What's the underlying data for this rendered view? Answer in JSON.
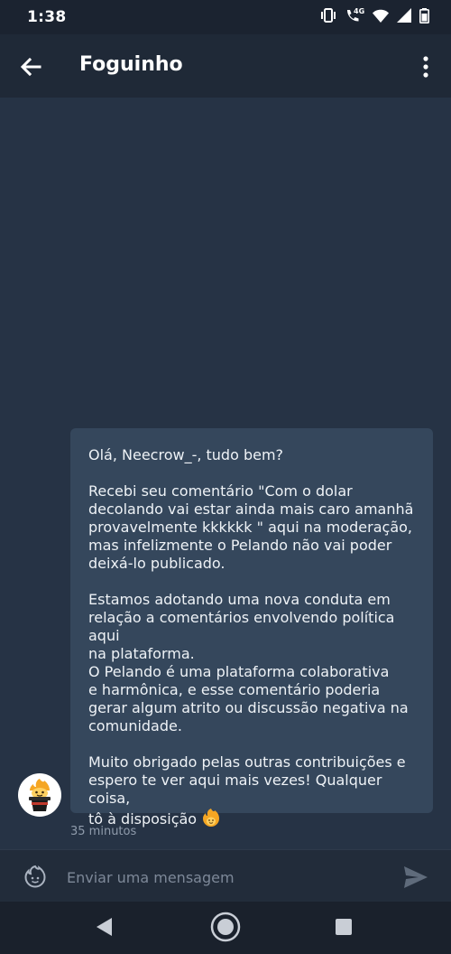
{
  "status_bar": {
    "time": "1:38",
    "network_label": "4G",
    "icons": [
      "vibrate-icon",
      "phone-4g-icon",
      "wifi-icon",
      "cell-signal-icon",
      "battery-icon"
    ]
  },
  "header": {
    "back_icon": "arrow-left-icon",
    "title": "Foguinho",
    "menu_icon": "more-vertical-icon"
  },
  "conversation": {
    "messages": [
      {
        "sender_avatar": "foguinho-mascot-avatar",
        "paragraphs": [
          "Olá, Neecrow_-, tudo bem?",
          "Recebi seu comentário \"Com o dolar\ndecolando vai estar ainda mais caro amanhã\nprovavelmente kkkkkk \" aqui na moderação,\nmas infelizmente o Pelando não vai poder\ndeixá-lo publicado.",
          "Estamos adotando uma nova conduta em\nrelação a comentários envolvendo política aqui\nna plataforma.\nO Pelando é uma plataforma colaborativa\ne harmônica, e esse comentário poderia\ngerar algum atrito ou discussão negativa na\ncomunidade.",
          "Muito obrigado pelas outras contribuições e\nespero te ver aqui mais vezes! Qualquer coisa,\ntô à disposição"
        ],
        "trailing_emoji": "fire-emoji-icon",
        "timestamp": "35 minutos"
      }
    ]
  },
  "composer": {
    "emoji_icon": "sticker-icon",
    "placeholder": "Enviar uma mensagem",
    "value": "",
    "send_icon": "send-icon"
  },
  "nav_bar": {
    "icons": [
      "nav-back-icon",
      "nav-home-icon",
      "nav-recents-icon"
    ]
  },
  "colors": {
    "status_bar": "#1b2330",
    "app_bar": "#1f2937",
    "chat_background": "#263345",
    "bubble": "#35475c",
    "accent_fire": "#f5a623"
  }
}
